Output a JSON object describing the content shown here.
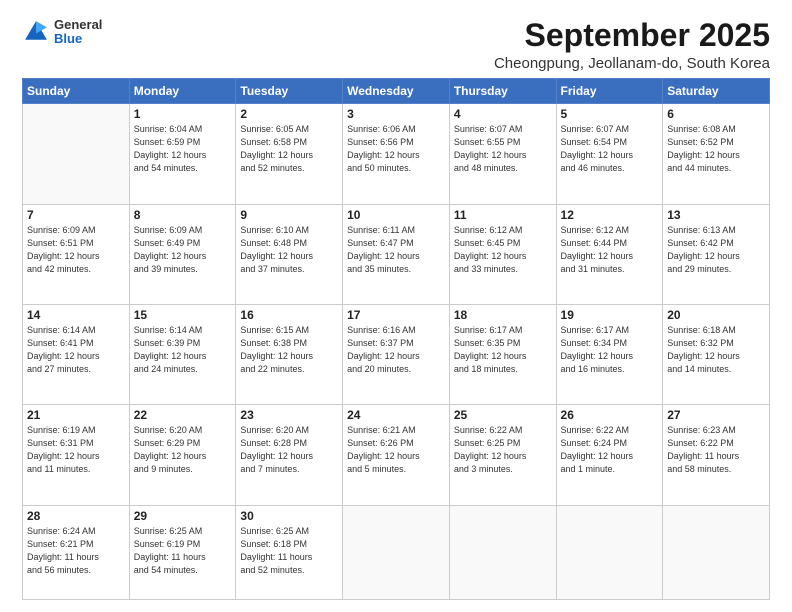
{
  "header": {
    "logo_line1": "General",
    "logo_line2": "Blue",
    "main_title": "September 2025",
    "subtitle": "Cheongpung, Jeollanam-do, South Korea"
  },
  "days_of_week": [
    "Sunday",
    "Monday",
    "Tuesday",
    "Wednesday",
    "Thursday",
    "Friday",
    "Saturday"
  ],
  "weeks": [
    [
      {
        "day": "",
        "info": ""
      },
      {
        "day": "1",
        "info": "Sunrise: 6:04 AM\nSunset: 6:59 PM\nDaylight: 12 hours\nand 54 minutes."
      },
      {
        "day": "2",
        "info": "Sunrise: 6:05 AM\nSunset: 6:58 PM\nDaylight: 12 hours\nand 52 minutes."
      },
      {
        "day": "3",
        "info": "Sunrise: 6:06 AM\nSunset: 6:56 PM\nDaylight: 12 hours\nand 50 minutes."
      },
      {
        "day": "4",
        "info": "Sunrise: 6:07 AM\nSunset: 6:55 PM\nDaylight: 12 hours\nand 48 minutes."
      },
      {
        "day": "5",
        "info": "Sunrise: 6:07 AM\nSunset: 6:54 PM\nDaylight: 12 hours\nand 46 minutes."
      },
      {
        "day": "6",
        "info": "Sunrise: 6:08 AM\nSunset: 6:52 PM\nDaylight: 12 hours\nand 44 minutes."
      }
    ],
    [
      {
        "day": "7",
        "info": "Sunrise: 6:09 AM\nSunset: 6:51 PM\nDaylight: 12 hours\nand 42 minutes."
      },
      {
        "day": "8",
        "info": "Sunrise: 6:09 AM\nSunset: 6:49 PM\nDaylight: 12 hours\nand 39 minutes."
      },
      {
        "day": "9",
        "info": "Sunrise: 6:10 AM\nSunset: 6:48 PM\nDaylight: 12 hours\nand 37 minutes."
      },
      {
        "day": "10",
        "info": "Sunrise: 6:11 AM\nSunset: 6:47 PM\nDaylight: 12 hours\nand 35 minutes."
      },
      {
        "day": "11",
        "info": "Sunrise: 6:12 AM\nSunset: 6:45 PM\nDaylight: 12 hours\nand 33 minutes."
      },
      {
        "day": "12",
        "info": "Sunrise: 6:12 AM\nSunset: 6:44 PM\nDaylight: 12 hours\nand 31 minutes."
      },
      {
        "day": "13",
        "info": "Sunrise: 6:13 AM\nSunset: 6:42 PM\nDaylight: 12 hours\nand 29 minutes."
      }
    ],
    [
      {
        "day": "14",
        "info": "Sunrise: 6:14 AM\nSunset: 6:41 PM\nDaylight: 12 hours\nand 27 minutes."
      },
      {
        "day": "15",
        "info": "Sunrise: 6:14 AM\nSunset: 6:39 PM\nDaylight: 12 hours\nand 24 minutes."
      },
      {
        "day": "16",
        "info": "Sunrise: 6:15 AM\nSunset: 6:38 PM\nDaylight: 12 hours\nand 22 minutes."
      },
      {
        "day": "17",
        "info": "Sunrise: 6:16 AM\nSunset: 6:37 PM\nDaylight: 12 hours\nand 20 minutes."
      },
      {
        "day": "18",
        "info": "Sunrise: 6:17 AM\nSunset: 6:35 PM\nDaylight: 12 hours\nand 18 minutes."
      },
      {
        "day": "19",
        "info": "Sunrise: 6:17 AM\nSunset: 6:34 PM\nDaylight: 12 hours\nand 16 minutes."
      },
      {
        "day": "20",
        "info": "Sunrise: 6:18 AM\nSunset: 6:32 PM\nDaylight: 12 hours\nand 14 minutes."
      }
    ],
    [
      {
        "day": "21",
        "info": "Sunrise: 6:19 AM\nSunset: 6:31 PM\nDaylight: 12 hours\nand 11 minutes."
      },
      {
        "day": "22",
        "info": "Sunrise: 6:20 AM\nSunset: 6:29 PM\nDaylight: 12 hours\nand 9 minutes."
      },
      {
        "day": "23",
        "info": "Sunrise: 6:20 AM\nSunset: 6:28 PM\nDaylight: 12 hours\nand 7 minutes."
      },
      {
        "day": "24",
        "info": "Sunrise: 6:21 AM\nSunset: 6:26 PM\nDaylight: 12 hours\nand 5 minutes."
      },
      {
        "day": "25",
        "info": "Sunrise: 6:22 AM\nSunset: 6:25 PM\nDaylight: 12 hours\nand 3 minutes."
      },
      {
        "day": "26",
        "info": "Sunrise: 6:22 AM\nSunset: 6:24 PM\nDaylight: 12 hours\nand 1 minute."
      },
      {
        "day": "27",
        "info": "Sunrise: 6:23 AM\nSunset: 6:22 PM\nDaylight: 11 hours\nand 58 minutes."
      }
    ],
    [
      {
        "day": "28",
        "info": "Sunrise: 6:24 AM\nSunset: 6:21 PM\nDaylight: 11 hours\nand 56 minutes."
      },
      {
        "day": "29",
        "info": "Sunrise: 6:25 AM\nSunset: 6:19 PM\nDaylight: 11 hours\nand 54 minutes."
      },
      {
        "day": "30",
        "info": "Sunrise: 6:25 AM\nSunset: 6:18 PM\nDaylight: 11 hours\nand 52 minutes."
      },
      {
        "day": "",
        "info": ""
      },
      {
        "day": "",
        "info": ""
      },
      {
        "day": "",
        "info": ""
      },
      {
        "day": "",
        "info": ""
      }
    ]
  ]
}
